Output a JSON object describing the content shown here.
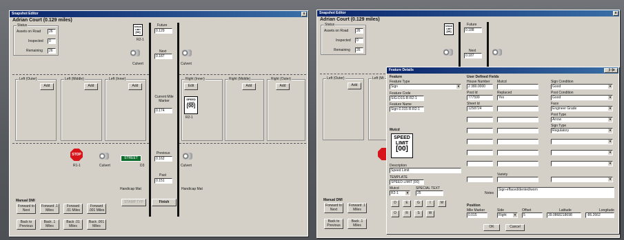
{
  "left_window": {
    "title": "Snapshot Editor",
    "close": "x",
    "heading": "Adrian Court (0.129 miles)",
    "status": {
      "label": "Status",
      "assets_label": "Assets on Road",
      "assets": "26",
      "inspected_label": "Inspected",
      "inspected": "0",
      "remaining_label": "Remaining",
      "remaining": "26"
    },
    "sign_top": {
      "text": "SPEED LIMIT\n[00]",
      "code": "R2-1"
    },
    "future_label": "Future",
    "future": "0.129",
    "next_label": "Next",
    "next": "0.187",
    "current_label": "Current Mile Marker",
    "current": "0.174",
    "previous_label": "Previous",
    "previous": "0.162",
    "past_label": "Past",
    "past": "0.151",
    "culvert": "Culvert",
    "left_cols": [
      {
        "label": "Left (Outer)",
        "btn": "Add"
      },
      {
        "label": "Left (Middle)",
        "btn": "Add"
      },
      {
        "label": "Left (Inner)",
        "btn": "Add"
      }
    ],
    "right_cols": [
      {
        "label": "Right (Inner)",
        "btn": "Edit"
      },
      {
        "label": "Right (Middle)",
        "btn": "Add"
      },
      {
        "label": "Right (Outer)",
        "btn": "Add"
      }
    ],
    "right_sign": {
      "line1": "SPEED",
      "line2": "LIMIT",
      "line3": "[00]",
      "code": "R2-1"
    },
    "stop": "STOP",
    "stop_code": "R1-1",
    "street": "STREET",
    "street_code": "D3",
    "handicap_left": "Handicap Mat",
    "handicap_right": "Handicap Mat",
    "manual_dmi": "Manual DMI",
    "fwd": [
      "Forward to Next",
      "Forward .1 Miles",
      "Forward .01 Miles",
      "Forward .001 Miles"
    ],
    "back": [
      "Back to Previous",
      "Back .1 Miles",
      "Back .01 Miles",
      "Back .001 Miles"
    ],
    "stamp": "STAMP TYP",
    "finish": "Finish"
  },
  "right_window": {
    "title": "Snapshot Editor",
    "close": "x",
    "heading": "Adrian Court (0.129 miles)",
    "status": {
      "label": "Status",
      "assets_label": "Assets on Road",
      "assets": "26",
      "inspected_label": "Inspected",
      "inspected": "0",
      "remaining_label": "Remaining",
      "remaining": "26"
    },
    "future_label": "Future",
    "future": "0.188",
    "next_label": "Next",
    "next": "0.187",
    "left_outer": "Left (Outer)",
    "left_mid": "Left (Mi",
    "add": "Add"
  },
  "dialog": {
    "title": "Feature Details",
    "ctl": "_|□|x",
    "feature_label": "Feature",
    "feature_type_label": "Feature Type",
    "feature_type": "Sign",
    "feature_code_label": "Feature Code",
    "feature_code": "SIG-D1S-R-R2-1",
    "feature_name_label": "Feature Name",
    "feature_name": "Sign-0.015-R-R2-1",
    "mutcd_label": "Mutcd",
    "sign": {
      "line1": "SPEED",
      "line2": "LIMIT",
      "line3": "[00]"
    },
    "description_label": "Description",
    "description": "Speed Limit",
    "template_label": "TEMPLATE",
    "template": "SPEED LIMIT [00]",
    "mutcd2_label": "Mutcd",
    "mutcd2": "R2-1",
    "special_label": "SPECIAL TEXT",
    "special": "25",
    "letters1": [
      "D",
      "E",
      "G",
      "I",
      "M"
    ],
    "letters2": [
      "O",
      "R",
      "S",
      "W"
    ],
    "udf_label": "User Defined Fields",
    "house_label": "House Number",
    "house": "2 380.0000",
    "mutcd_field_label": "Mutcd",
    "mutcd_field": "",
    "post_label": "Post Id",
    "post": "777599",
    "replaced_label": "Replaced",
    "replaced": "Yes",
    "sheet_label": "Sheet Id",
    "sheet": "1258724",
    "variety_label": "Variety",
    "notes_label": "Notes",
    "notes": "Sign-effaced/dented/worn",
    "sign_cond_label": "Sign Condition",
    "sign_cond": "Good",
    "post_cond_label": "Post Condition",
    "post_cond": "Good",
    "face_label": "Face",
    "face": "Engineer Grade",
    "post_type_label": "Post Type",
    "post_type": "Arrow",
    "sign_type_label": "Sign Type",
    "sign_type": "Regulatory",
    "position_label": "Position",
    "mile_label": "Mile Marker",
    "mile": "0.015",
    "side_label": "Side",
    "side": "Right",
    "offset_label": "Offset",
    "offset": "5",
    "lat_label": "Latitude",
    "lat": "39.0868218698",
    "lon_label": "Longitude",
    "lon": "-86.2662",
    "ok": "OK",
    "cancel": "Cancel"
  }
}
